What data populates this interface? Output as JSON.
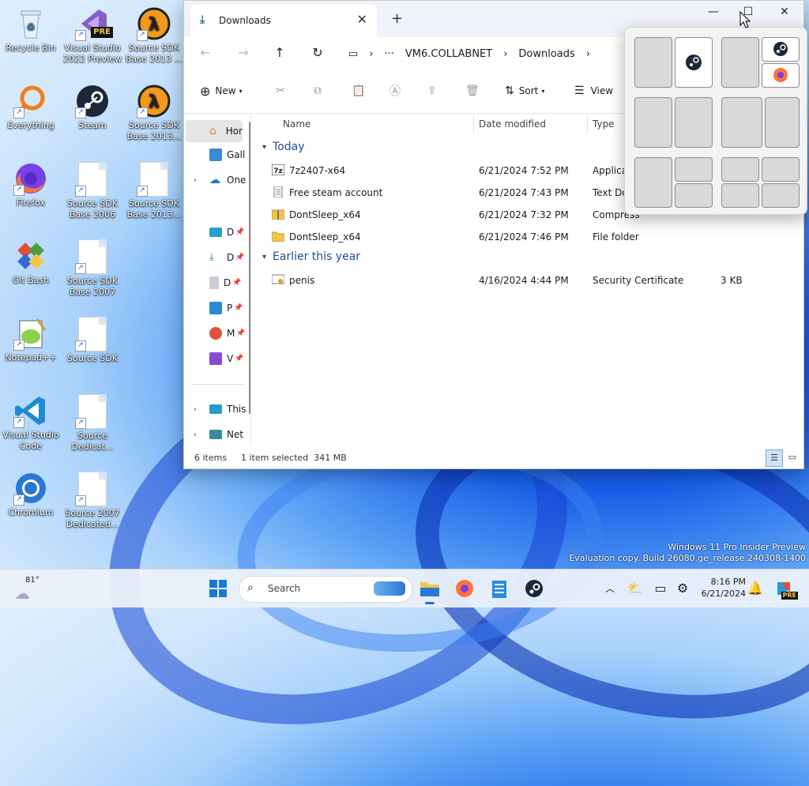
{
  "desktop": {
    "icons": [
      {
        "label": "Recycle Bin"
      },
      {
        "label": "Visual Studio 2022 Preview"
      },
      {
        "label": "Source SDK Base 2013 ..."
      },
      {
        "label": "Everything"
      },
      {
        "label": "Steam"
      },
      {
        "label": "Source SDK Base 2013..."
      },
      {
        "label": "Firefox"
      },
      {
        "label": "Source SDK Base 2006"
      },
      {
        "label": "Source SDK Base 2013..."
      },
      {
        "label": "Git Bash"
      },
      {
        "label": "Source SDK Base 2007"
      },
      {
        "label": "Notepad++"
      },
      {
        "label": "Source SDK"
      },
      {
        "label": "Visual Studio Code"
      },
      {
        "label": "Source Dedicat..."
      },
      {
        "label": "Chromium"
      },
      {
        "label": "Source 2007 Dedicated..."
      }
    ],
    "badges": {
      "pre": "PRE",
      "half_life": "λ"
    }
  },
  "explorer": {
    "tab_title": "Downloads",
    "breadcrumbs": [
      "VM6.COLLABNET",
      "Downloads"
    ],
    "toolbar": {
      "new_label": "New",
      "sort_label": "Sort",
      "view_label": "View"
    },
    "sidebar": [
      "Hor",
      "Gall",
      "One",
      "D",
      "D",
      "D",
      "P",
      "M",
      "V",
      "This",
      "Net"
    ],
    "columns": {
      "name": "Name",
      "date": "Date modified",
      "type": "Type"
    },
    "groups": {
      "today": "Today",
      "earlier": "Earlier this year"
    },
    "files_today": [
      {
        "name": "7z2407-x64",
        "date": "6/21/2024 7:52 PM",
        "type": "Applica",
        "size": ""
      },
      {
        "name": "Free steam account",
        "date": "6/21/2024 7:43 PM",
        "type": "Text Do",
        "size": ""
      },
      {
        "name": "DontSleep_x64",
        "date": "6/21/2024 7:32 PM",
        "type": "Compress",
        "size": ""
      },
      {
        "name": "DontSleep_x64",
        "date": "6/21/2024 7:46 PM",
        "type": "File folder",
        "size": ""
      }
    ],
    "files_earlier": [
      {
        "name": "penis",
        "date": "4/16/2024 4:44 PM",
        "type": "Security Certificate",
        "size": "3 KB"
      }
    ],
    "status": {
      "items": "6 items",
      "selected": "1 item selected  341 MB"
    }
  },
  "taskbar": {
    "weather_temp": "81°",
    "search_placeholder": "Search",
    "time": "8:16 PM",
    "date": "6/21/2024",
    "copilot_badge": "PRE"
  },
  "watermark": {
    "line1": "Windows 11 Pro Insider Preview",
    "line2": "Evaluation copy. Build 26080.ge_release.240308-1400"
  },
  "colors": {
    "accent": "#1a5ee8",
    "folder": "#f2c54b",
    "steam": "#1b2838"
  }
}
